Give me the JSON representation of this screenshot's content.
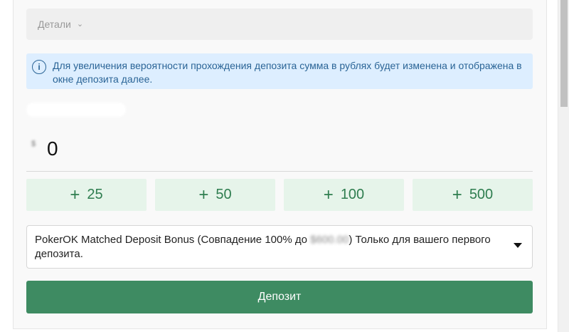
{
  "details": {
    "label": "Детали"
  },
  "info": {
    "text": "Для увеличения вероятности прохождения депозита сумма в рублях будет изменена и отображена в окне депозита далее."
  },
  "amount": {
    "currency_symbol": "$",
    "value": "0"
  },
  "quick_amounts": [
    {
      "sign": "+",
      "value": "25"
    },
    {
      "sign": "+",
      "value": "50"
    },
    {
      "sign": "+",
      "value": "100"
    },
    {
      "sign": "+",
      "value": "500"
    }
  ],
  "bonus": {
    "text_before": "PokerOK Matched Deposit Bonus (Совпадение 100% до ",
    "hidden_amount": "$600.00",
    "text_after": ") Только для вашего первого депозита."
  },
  "deposit_button": {
    "label": "Депозит"
  },
  "colors": {
    "primary": "#3e8b62",
    "quick_bg": "#e6f4ea",
    "info_bg": "#ddeeff",
    "info_text": "#2a6496"
  }
}
